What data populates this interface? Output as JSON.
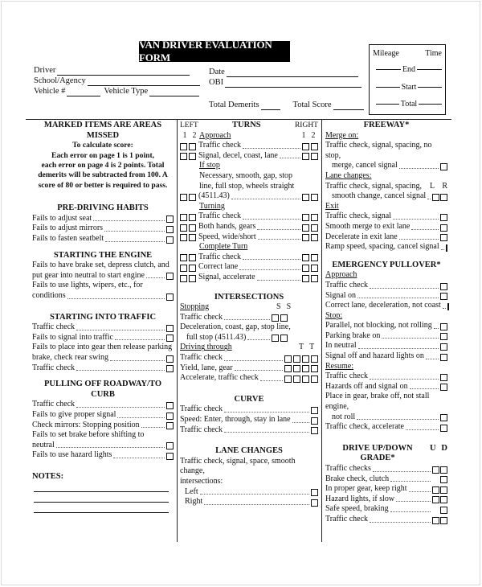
{
  "header": {
    "title": "VAN DRIVER EVALUATION FORM",
    "fields": {
      "driver": "Driver",
      "school_agency": "School/Agency",
      "vehicle_no": "Vehicle #",
      "vehicle_type": "Vehicle Type",
      "date": "Date",
      "obi": "OBI",
      "total_demerits": "Total Demerits",
      "total_score": "Total Score"
    },
    "mileage_box": {
      "mileage": "Mileage",
      "time": "Time",
      "rows": [
        "End",
        "Start",
        "Total"
      ]
    }
  },
  "left_column": {
    "instructions": {
      "heading": "MARKED ITEMS ARE AREAS MISSED",
      "lines": [
        "To calculate score:",
        "Each error on page 1 is 1 point,",
        "each error on page 4 is 2 points. Total",
        "demerits will be subtracted from 100. A",
        "score of 80 or better is required to pass."
      ]
    },
    "pre_driving": {
      "heading": "PRE-DRIVING HABITS",
      "items": [
        "Fails to adjust seat",
        "Fails to adjust mirrors",
        "Fails to fasten seatbelt"
      ]
    },
    "starting_engine": {
      "heading": "STARTING THE ENGINE",
      "items": [
        [
          "Fails to have brake set, depress clutch, and",
          "put gear into neutral to start engine"
        ],
        [
          "Fails to use lights, wipers, etc., for",
          "conditions"
        ]
      ]
    },
    "starting_traffic": {
      "heading": "STARTING INTO TRAFFIC",
      "items": [
        [
          "Traffic check"
        ],
        [
          "Fails to signal into traffic"
        ],
        [
          "Fails to place into gear then release parking",
          "brake, check rear swing"
        ],
        [
          "Traffic check"
        ]
      ]
    },
    "pulling_off": {
      "heading": "PULLING OFF ROADWAY/TO CURB",
      "items": [
        [
          "Traffic check"
        ],
        [
          "Fails to give proper signal"
        ],
        [
          "Check mirrors:  Stopping position"
        ],
        [
          "Fails to set brake before shifting to",
          "neutral"
        ],
        [
          "Fails to use hazard lights"
        ]
      ]
    },
    "notes": {
      "heading": "NOTES:"
    }
  },
  "middle_column": {
    "turns": {
      "heading": "TURNS",
      "left_label": "LEFT",
      "right_label": "RIGHT",
      "num1": "1",
      "num2": "2",
      "approach": "Approach",
      "approach_items": [
        "Traffic check",
        "Signal, decel, coast, lane"
      ],
      "if_stop": "If stop",
      "if_stop_lines": [
        "Necessary, smooth, gap, stop",
        "line, full stop, wheels straight",
        "(4511.43)"
      ],
      "turning": "Turning",
      "turning_items": [
        "Traffic check",
        "Both hands, gears",
        "Speed, wide/short"
      ],
      "complete_turn": "Complete Turn",
      "complete_items": [
        "Traffic check",
        "Correct lane",
        "Signal, accelerate"
      ]
    },
    "intersections": {
      "heading": "INTERSECTIONS",
      "stopping": "Stopping",
      "s_label": "S",
      "stopping_items": [
        [
          "Traffic check"
        ],
        [
          "Deceleration, coast, gap, stop line,",
          "full stop (4511.43)"
        ]
      ],
      "driving_through": "Driving through",
      "t_label": "T",
      "driving_items": [
        "Traffic check",
        "Yield, lane, gear",
        "Accelerate, traffic check"
      ]
    },
    "curve": {
      "heading": "CURVE",
      "items": [
        "Traffic check",
        "Speed:  Enter, through, stay in lane",
        "Traffic check"
      ]
    },
    "lane_changes": {
      "heading": "LANE CHANGES",
      "lines": [
        "Traffic check, signal, space, smooth change,",
        "intersections:"
      ],
      "items": [
        "Left",
        "Right"
      ]
    }
  },
  "right_column": {
    "freeway": {
      "heading": "FREEWAY*",
      "merge_on": "Merge on:",
      "merge_item": [
        "Traffic check, signal, spacing, no stop,",
        "merge, cancel signal"
      ],
      "lane_changes": "Lane changes:",
      "lr_labels": [
        "L",
        "R"
      ],
      "lane_item": [
        "Traffic check, signal, spacing,",
        "smooth change, cancel signal"
      ],
      "exit": "Exit",
      "exit_items": [
        "Traffic check, signal",
        "Smooth merge to exit lane",
        "Decelerate in exit lane",
        "Ramp speed, spacing, cancel signal"
      ]
    },
    "emergency": {
      "heading": "EMERGENCY PULLOVER*",
      "approach": "Approach",
      "approach_items": [
        "Traffic check",
        "Signal on",
        "Correct lane, deceleration, not coast"
      ],
      "stop": "Stop:",
      "stop_items": [
        "Parallel, not blocking, not rolling",
        "Parking brake on",
        "In neutral",
        "Signal off and hazard lights on"
      ],
      "resume": "Resume:",
      "resume_items": [
        [
          "Traffic check"
        ],
        [
          "Hazards off and signal on"
        ],
        [
          "Place in gear, brake off, not stall engine,",
          "not roll"
        ],
        [
          "Traffic check, accelerate"
        ]
      ]
    },
    "grade": {
      "heading": "DRIVE UP/DOWN GRADE*",
      "u": "U",
      "d": "D",
      "items": [
        {
          "label": "Traffic checks",
          "boxes": 2
        },
        {
          "label": "Brake check, clutch",
          "boxes": 1
        },
        {
          "label": "In proper gear, keep right",
          "boxes": 2
        },
        {
          "label": "Hazard lights, if slow",
          "boxes": 2
        },
        {
          "label": "Safe speed, braking",
          "boxes": 1
        },
        {
          "label": "Traffic check",
          "boxes": 2
        }
      ]
    }
  }
}
